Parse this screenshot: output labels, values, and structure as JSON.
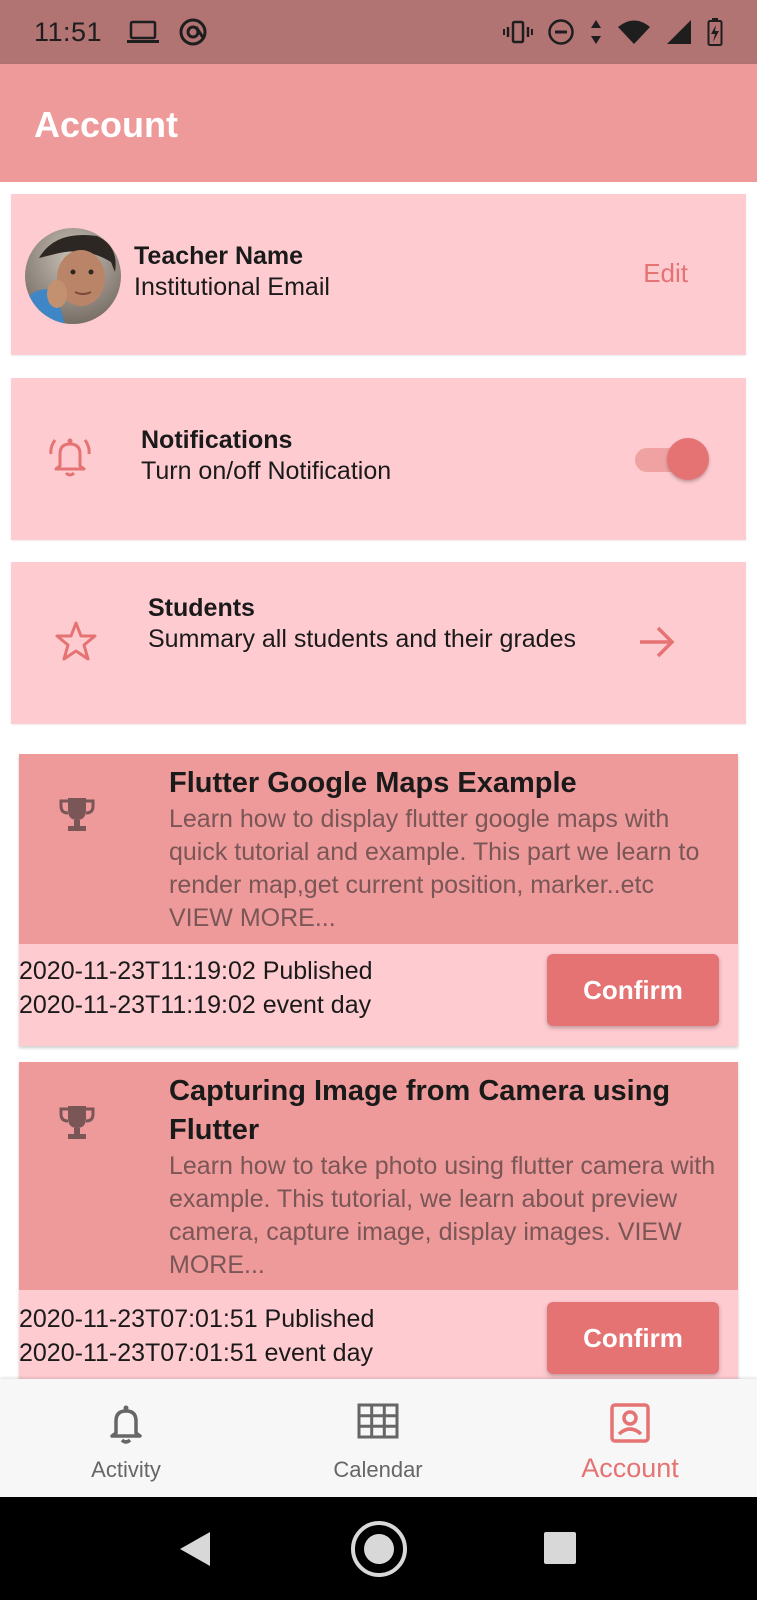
{
  "status_bar": {
    "time": "11:51"
  },
  "app_bar": {
    "title": "Account"
  },
  "profile": {
    "name": "Teacher Name",
    "email": "Institutional Email",
    "edit_label": "Edit"
  },
  "notifications": {
    "title": "Notifications",
    "subtitle": "Turn on/off Notification",
    "enabled": true
  },
  "students": {
    "title": "Students",
    "subtitle": "Summary all students and their grades"
  },
  "events": [
    {
      "title": "Flutter Google Maps Example",
      "description": "Learn how to display flutter google maps with quick tutorial and example. This part we learn to render map,get current position, marker..etc VIEW MORE...",
      "published": "2020-11-23T11:19:02 Published",
      "event_day": "2020-11-23T11:19:02 event day",
      "confirm_label": "Confirm"
    },
    {
      "title": "Capturing Image from Camera using Flutter",
      "description": "Learn how to take photo using flutter camera with example. This tutorial, we learn about preview camera, capture image, display images. VIEW MORE...",
      "published": "2020-11-23T07:01:51 Published",
      "event_day": "2020-11-23T07:01:51 event day",
      "confirm_label": "Confirm"
    }
  ],
  "bottom_nav": {
    "items": [
      {
        "label": "Activity",
        "icon": "bell-icon"
      },
      {
        "label": "Calendar",
        "icon": "grid-icon"
      },
      {
        "label": "Account",
        "icon": "account-box-icon",
        "active": true
      }
    ]
  },
  "colors": {
    "primary": "#e57373",
    "app_bar": "#ee9a9a",
    "card": "#fecbd0",
    "status_bar": "#b27373"
  }
}
